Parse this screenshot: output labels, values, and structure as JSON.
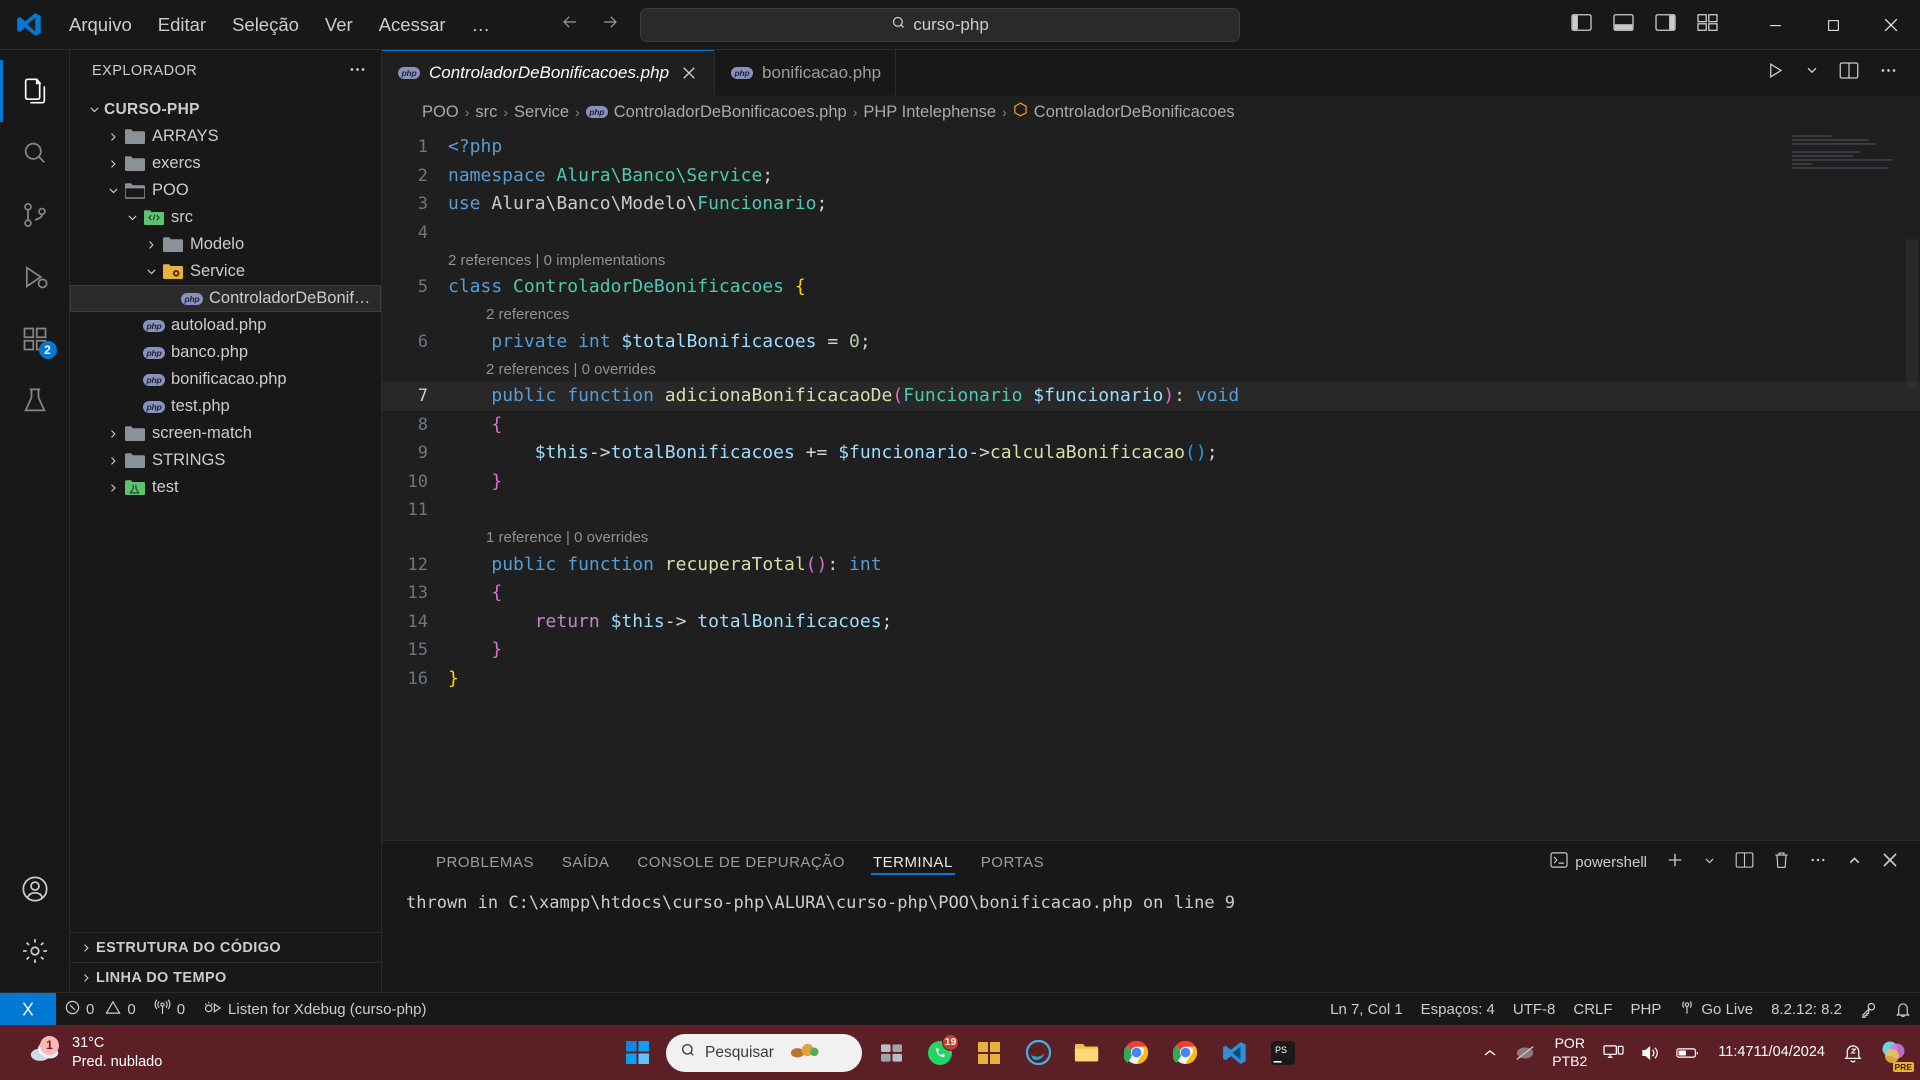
{
  "titlebar": {
    "logo_icon": "vscode-logo-icon",
    "menu": [
      "Arquivo",
      "Editar",
      "Seleção",
      "Ver",
      "Acessar"
    ],
    "more_label": "…",
    "back_icon": "arrow-left-icon",
    "forward_icon": "arrow-right-icon",
    "search": {
      "icon": "search-icon",
      "value": "curso-php"
    },
    "layout_icons": [
      "toggle-primary-sidebar-icon",
      "toggle-panel-icon",
      "toggle-secondary-sidebar-icon",
      "customize-layout-icon"
    ],
    "window_controls": {
      "minimize": "—",
      "maximize": "□",
      "close": "✕"
    }
  },
  "activitybar": {
    "items": [
      {
        "name": "explorer",
        "icon": "files-icon",
        "active": true,
        "badge": ""
      },
      {
        "name": "search",
        "icon": "search-icon",
        "active": false,
        "badge": ""
      },
      {
        "name": "source-control",
        "icon": "source-control-icon",
        "active": false,
        "badge": ""
      },
      {
        "name": "run-and-debug",
        "icon": "debug-icon",
        "active": false,
        "badge": ""
      },
      {
        "name": "extensions",
        "icon": "extensions-icon",
        "active": false,
        "badge": "2"
      },
      {
        "name": "testing",
        "icon": "beaker-icon",
        "active": false,
        "badge": ""
      }
    ],
    "bottom": [
      {
        "name": "accounts",
        "icon": "account-icon"
      },
      {
        "name": "settings",
        "icon": "gear-icon"
      }
    ]
  },
  "sidebar": {
    "title": "EXPLORADOR",
    "more_icon": "ellipsis-icon",
    "root": "CURSO-PHP",
    "tree": [
      {
        "label": "ARRAYS",
        "depth": 1,
        "type": "folder",
        "expanded": false,
        "selected": false
      },
      {
        "label": "exercs",
        "depth": 1,
        "type": "folder",
        "expanded": false,
        "selected": false
      },
      {
        "label": "POO",
        "depth": 1,
        "type": "folder",
        "expanded": true,
        "selected": false
      },
      {
        "label": "src",
        "depth": 2,
        "type": "folder-src",
        "expanded": true,
        "selected": false
      },
      {
        "label": "Modelo",
        "depth": 3,
        "type": "folder",
        "expanded": false,
        "selected": false
      },
      {
        "label": "Service",
        "depth": 3,
        "type": "folder-service",
        "expanded": true,
        "selected": false
      },
      {
        "label": "ControladorDeBonif…",
        "depth": 4,
        "type": "php",
        "expanded": null,
        "selected": true
      },
      {
        "label": "autoload.php",
        "depth": 2,
        "type": "php",
        "expanded": null,
        "selected": false
      },
      {
        "label": "banco.php",
        "depth": 2,
        "type": "php",
        "expanded": null,
        "selected": false
      },
      {
        "label": "bonificacao.php",
        "depth": 2,
        "type": "php",
        "expanded": null,
        "selected": false
      },
      {
        "label": "test.php",
        "depth": 2,
        "type": "php",
        "expanded": null,
        "selected": false
      },
      {
        "label": "screen-match",
        "depth": 1,
        "type": "folder",
        "expanded": false,
        "selected": false
      },
      {
        "label": "STRINGS",
        "depth": 1,
        "type": "folder",
        "expanded": false,
        "selected": false
      },
      {
        "label": "test",
        "depth": 1,
        "type": "folder-test",
        "expanded": false,
        "selected": false
      }
    ],
    "sections": [
      "ESTRUTURA DO CÓDIGO",
      "LINHA DO TEMPO"
    ]
  },
  "editor": {
    "tabs": [
      {
        "label": "ControladorDeBonificacoes.php",
        "icon": "php-file-icon",
        "active": true,
        "close_icon": "close-icon"
      },
      {
        "label": "bonificacao.php",
        "icon": "php-file-icon",
        "active": false,
        "close_icon": ""
      }
    ],
    "tab_actions": [
      "run-icon",
      "chevron-down-icon",
      "split-editor-icon",
      "more-actions-icon"
    ],
    "breadcrumbs": [
      "POO",
      "src",
      "Service",
      "ControladorDeBonificacoes.php",
      "PHP Intelephense",
      "ControladorDeBonificacoes"
    ],
    "breadcrumb_separator": "›",
    "code_lens": [
      {
        "before_line": 5,
        "text": "2 references | 0 implementations",
        "indent": 0
      },
      {
        "before_line": 6,
        "text": "2 references",
        "indent": 1
      },
      {
        "before_line": 7,
        "text": "2 references | 0 overrides",
        "indent": 1
      },
      {
        "before_line": 12,
        "text": "1 reference | 0 overrides",
        "indent": 1
      }
    ],
    "lines": [
      {
        "n": 1,
        "text": "<?php"
      },
      {
        "n": 2,
        "text": "namespace Alura\\Banco\\Service;"
      },
      {
        "n": 3,
        "text": "use Alura\\Banco\\Modelo\\Funcionario;"
      },
      {
        "n": 4,
        "text": ""
      },
      {
        "n": 5,
        "text": "class ControladorDeBonificacoes {"
      },
      {
        "n": 6,
        "text": "    private int $totalBonificacoes = 0;"
      },
      {
        "n": 7,
        "text": "    public function adicionaBonificacaoDe(Funcionario $funcionario): void"
      },
      {
        "n": 8,
        "text": "    {"
      },
      {
        "n": 9,
        "text": "        $this->totalBonificacoes += $funcionario->calculaBonificacao();"
      },
      {
        "n": 10,
        "text": "    }"
      },
      {
        "n": 11,
        "text": ""
      },
      {
        "n": 12,
        "text": "    public function recuperaTotal(): int"
      },
      {
        "n": 13,
        "text": "    {"
      },
      {
        "n": 14,
        "text": "        return $this-> totalBonificacoes;"
      },
      {
        "n": 15,
        "text": "    }"
      },
      {
        "n": 16,
        "text": "}"
      }
    ],
    "current_line": 7
  },
  "panel": {
    "tabs": [
      "PROBLEMAS",
      "SAÍDA",
      "CONSOLE DE DEPURAÇÃO",
      "TERMINAL",
      "PORTAS"
    ],
    "active_tab": "TERMINAL",
    "shell_label": "powershell",
    "shell_icon": "terminal-icon",
    "actions": [
      "add-terminal-icon",
      "chevron-down-icon",
      "split-terminal-icon",
      "kill-terminal-icon",
      "more-actions-icon",
      "maximize-panel-icon",
      "close-panel-icon"
    ],
    "output": "thrown in C:\\xampp\\htdocs\\curso-php\\ALURA\\curso-php\\POO\\bonificacao.php on line 9"
  },
  "statusbar": {
    "remote_icon": "remote-window-icon",
    "left": [
      {
        "icon": "error-icon",
        "label": "0"
      },
      {
        "icon": "warning-icon",
        "label": "0"
      },
      {
        "icon": "radio-tower-icon",
        "label": "0"
      },
      {
        "icon": "debug-start-icon",
        "label": "Listen for Xdebug (curso-php)"
      }
    ],
    "right": [
      {
        "icon": "",
        "label": "Ln 7, Col 1"
      },
      {
        "icon": "",
        "label": "Espaços: 4"
      },
      {
        "icon": "",
        "label": "UTF-8"
      },
      {
        "icon": "",
        "label": "CRLF"
      },
      {
        "icon": "",
        "label": "PHP"
      },
      {
        "icon": "broadcast-icon",
        "label": "Go Live"
      },
      {
        "icon": "",
        "label": "8.2.12: 8.2"
      },
      {
        "icon": "key-icon",
        "label": ""
      },
      {
        "icon": "bell-icon",
        "label": ""
      }
    ]
  },
  "taskbar": {
    "weather": {
      "temp": "31°C",
      "desc": "Pred. nublado",
      "badge": "1",
      "icon": "cloud-icon"
    },
    "center": [
      {
        "name": "start",
        "icon": "windows-start-icon",
        "badge": ""
      },
      {
        "name": "search",
        "icon": "search-icon",
        "label": "Pesquisar",
        "badge": ""
      },
      {
        "name": "widgets",
        "icon": "widgets-icon",
        "badge": ""
      },
      {
        "name": "task-view",
        "icon": "task-view-icon",
        "badge": ""
      },
      {
        "name": "whatsapp",
        "icon": "whatsapp-icon",
        "badge": "19"
      },
      {
        "name": "microsoft-store",
        "icon": "store-icon",
        "badge": ""
      },
      {
        "name": "edge",
        "icon": "edge-icon",
        "badge": ""
      },
      {
        "name": "file-explorer",
        "icon": "folder-icon",
        "badge": ""
      },
      {
        "name": "chrome",
        "icon": "chrome-icon",
        "badge": ""
      },
      {
        "name": "chrome-2",
        "icon": "chrome-icon",
        "badge": ""
      },
      {
        "name": "vscode",
        "icon": "vscode-logo-icon",
        "badge": ""
      },
      {
        "name": "phpstorm",
        "icon": "phpstorm-icon",
        "badge": ""
      }
    ],
    "tray": {
      "expand_icon": "chevron-up-icon",
      "pen_icon": "pen-icon",
      "language": {
        "line1": "POR",
        "line2": "PTB2"
      },
      "network_icon": "network-icon",
      "volume_icon": "volume-icon",
      "battery_icon": "battery-icon",
      "clock": {
        "time": "11:47",
        "date": "11/04/2024"
      },
      "notification_icon": "bell-dnd-icon",
      "copilot_icon": "copilot-icon",
      "copilot_badge": "PRE"
    }
  },
  "colors": {
    "accent": "#0078d4",
    "editor_bg": "#1f1f1f",
    "chrome_bg": "#181818",
    "taskbar_bg": "#5c1f25",
    "keyword": "#569cd6",
    "control": "#c586c0",
    "class": "#4ec9b0",
    "variable": "#9cdcfe",
    "function": "#dcdcaa",
    "number": "#b5cea8"
  }
}
